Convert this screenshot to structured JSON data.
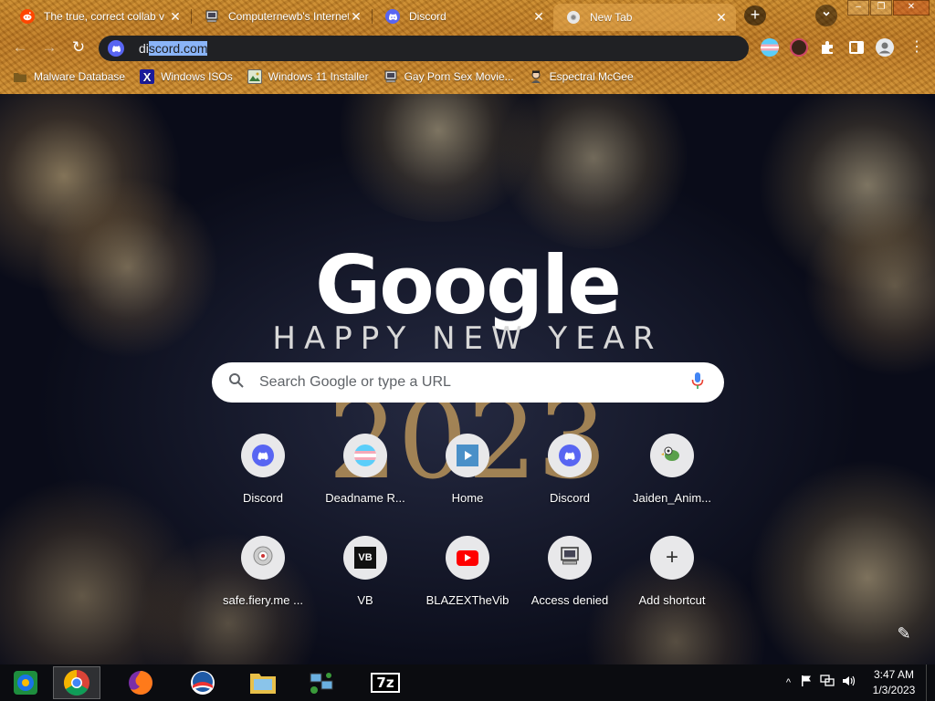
{
  "browser": {
    "tabs": [
      {
        "title": "The true, correct collab v",
        "icon": "reddit-icon",
        "color": "#ff4500"
      },
      {
        "title": "Computernewb's Internet",
        "icon": "computer-icon",
        "color": "#cfcfcf"
      },
      {
        "title": "Discord",
        "icon": "discord-icon",
        "color": "#5865f2"
      },
      {
        "title": "New Tab",
        "icon": "chrome-icon",
        "color": "#cfcfcf"
      }
    ],
    "active_tab_index": 3,
    "newtab_symbol": "+",
    "tabsearch_symbol": "⌄",
    "window_controls": {
      "minimize": "–",
      "maximize": "❐",
      "close": "✕"
    },
    "nav": {
      "back": "←",
      "forward": "→",
      "reload": "↻"
    },
    "omnibox": {
      "prefix": "di",
      "selected": "scord.com"
    },
    "menu_symbol": "⋮",
    "bookmarks": [
      {
        "label": "Malware Database",
        "icon": "folder-icon"
      },
      {
        "label": "Windows ISOs",
        "icon": "x-icon"
      },
      {
        "label": "Windows 11 Installer",
        "icon": "image-icon"
      },
      {
        "label": "Gay Porn Sex Movie...",
        "icon": "computer-icon"
      },
      {
        "label": "Espectral McGee",
        "icon": "avatar-icon"
      }
    ]
  },
  "ntp": {
    "logo": "Google",
    "doodle_subtitle": "HAPPY NEW YEAR",
    "doodle_year": "2023",
    "search_placeholder": "Search Google or type a URL",
    "shortcuts": [
      {
        "label": "Discord",
        "icon": "discord-icon"
      },
      {
        "label": "Deadname R...",
        "icon": "flag-icon"
      },
      {
        "label": "Home",
        "icon": "play-icon"
      },
      {
        "label": "Discord",
        "icon": "discord-icon"
      },
      {
        "label": "Jaiden_Anim...",
        "icon": "bird-icon"
      },
      {
        "label": "safe.fiery.me ...",
        "icon": "globe-icon"
      },
      {
        "label": "VB",
        "icon": "vb-icon"
      },
      {
        "label": "BLAZEXTheVib",
        "icon": "youtube-icon"
      },
      {
        "label": "Access denied",
        "icon": "computer-icon"
      },
      {
        "label": "Add shortcut",
        "icon": "plus-icon"
      }
    ],
    "customize_symbol": "✎"
  },
  "taskbar": {
    "apps": [
      "media-center-icon",
      "chrome-icon",
      "firefox-icon",
      "obama-icon",
      "file-explorer-icon",
      "network-icon",
      "7zip-icon"
    ],
    "zip_label": "7z",
    "tray_expand": "^",
    "clock": {
      "time": "3:47 AM",
      "date": "1/3/2023"
    }
  }
}
